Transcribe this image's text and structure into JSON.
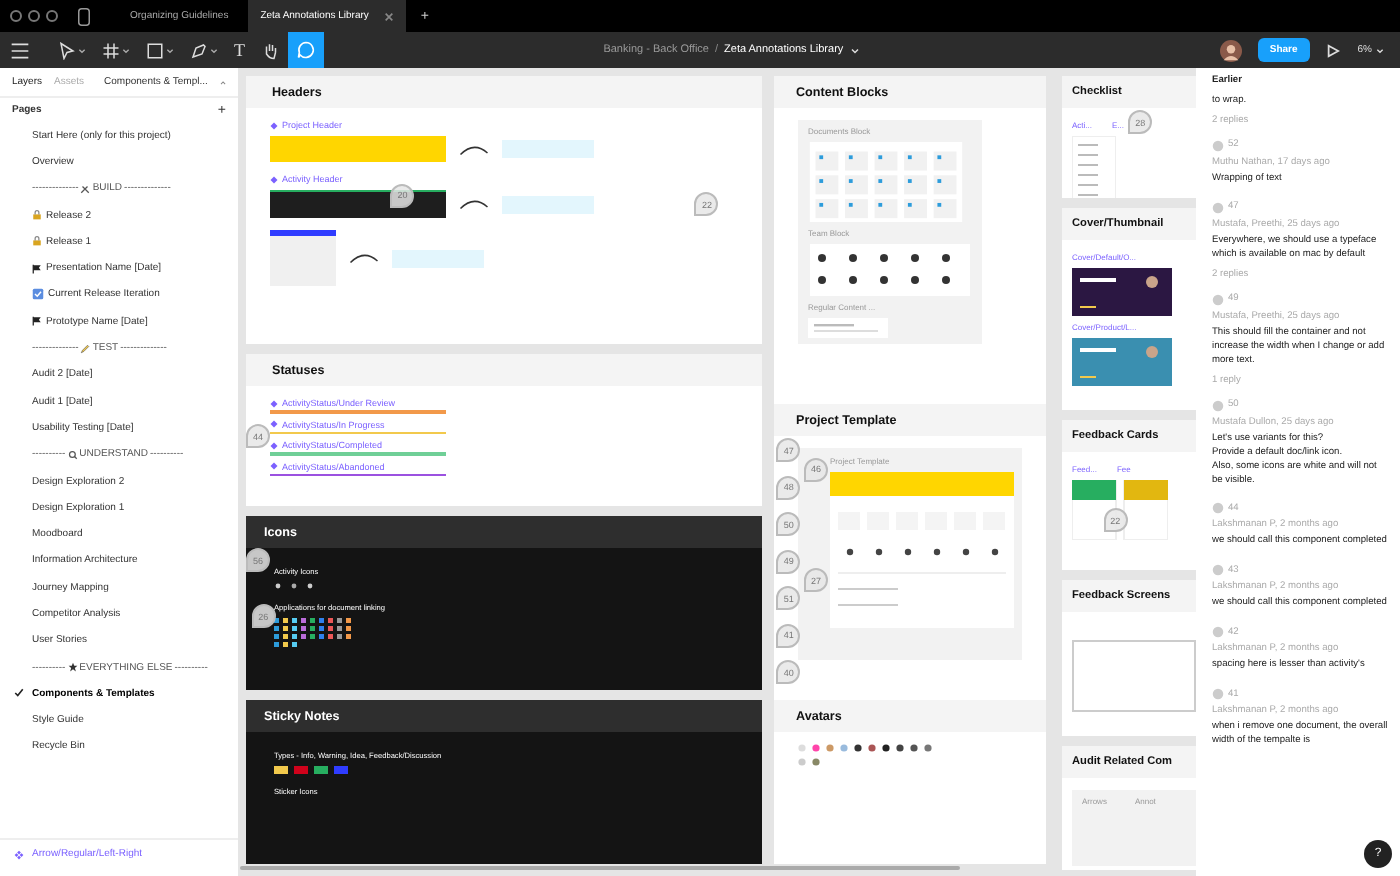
{
  "tabs": [
    {
      "label": "Organizing Guidelines",
      "selected": false,
      "closable": false
    },
    {
      "label": "Zeta Annotations Library",
      "selected": true,
      "closable": true
    }
  ],
  "new_tab": "+",
  "toolbar": {
    "tools": [
      {
        "kind": "move",
        "selected": false
      },
      {
        "kind": "frame",
        "selected": false
      },
      {
        "kind": "shape",
        "selected": false
      },
      {
        "kind": "pen",
        "selected": false
      },
      {
        "kind": "text",
        "glyph": "T",
        "selected": false
      },
      {
        "kind": "hand",
        "selected": false
      },
      {
        "kind": "comment",
        "selected": true
      }
    ],
    "project": "Banking - Back Office",
    "separator": "/",
    "file": "Zeta Annotations Library",
    "share": "Share",
    "zoom": "6%"
  },
  "sidebar": {
    "tabs": [
      {
        "label": "Layers",
        "selected": true
      },
      {
        "label": "Assets",
        "selected": false
      }
    ],
    "page_menu": "Components & Templ...",
    "pages_title": "Pages",
    "add": "+",
    "pages": [
      {
        "kind": "page",
        "label": "Start Here (only for this project)",
        "selected": false
      },
      {
        "kind": "page",
        "label": "Overview",
        "selected": false
      },
      {
        "kind": "divider",
        "left": "--------------",
        "label": "BUILD",
        "right": "--------------"
      },
      {
        "kind": "locked",
        "label": "Release 2",
        "selected": false
      },
      {
        "kind": "locked",
        "label": "Release 1",
        "selected": false
      },
      {
        "kind": "flagged",
        "label": "Presentation Name [Date]",
        "selected": false
      },
      {
        "kind": "checkbox",
        "label": "Current Release Iteration",
        "selected": false
      },
      {
        "kind": "flagged",
        "label": "Prototype Name [Date]",
        "selected": false
      },
      {
        "kind": "divider",
        "left": "--------------",
        "label": "TEST",
        "right": "--------------"
      },
      {
        "kind": "page",
        "label": "Audit 2 [Date]",
        "selected": false
      },
      {
        "kind": "page",
        "label": "Audit 1 [Date]",
        "selected": false
      },
      {
        "kind": "page",
        "label": "Usability Testing [Date]",
        "selected": false
      },
      {
        "kind": "divider",
        "left": "----------",
        "label": "UNDERSTAND",
        "right": "----------"
      },
      {
        "kind": "page",
        "label": "Design Exploration 2",
        "selected": false
      },
      {
        "kind": "page",
        "label": "Design Exploration 1",
        "selected": false
      },
      {
        "kind": "page",
        "label": "Moodboard",
        "selected": false
      },
      {
        "kind": "page",
        "label": "Information Architecture",
        "selected": false
      },
      {
        "kind": "page",
        "label": "Journey Mapping",
        "selected": false
      },
      {
        "kind": "page",
        "label": "Competitor Analysis",
        "selected": false
      },
      {
        "kind": "page",
        "label": "User Stories",
        "selected": false
      },
      {
        "kind": "divider",
        "left": "----------",
        "label": "EVERYTHING ELSE",
        "right": "----------"
      },
      {
        "kind": "page",
        "label": "Components & Templates",
        "selected": true
      },
      {
        "kind": "page",
        "label": "Style Guide",
        "selected": false
      },
      {
        "kind": "page",
        "label": "Recycle Bin",
        "selected": false
      }
    ],
    "selected_layer": "Arrow/Regular/Left-Right"
  },
  "canvas": {
    "columns": [
      [
        {
          "kind": "headers",
          "title": "Headers",
          "dark": false,
          "pins": [
            "20",
            "22"
          ],
          "labels": [
            "Project Header",
            "Activity Header"
          ]
        },
        {
          "kind": "statuses",
          "title": "Statuses",
          "dark": false,
          "pins": [
            "44"
          ],
          "statuses": [
            {
              "label": "ActivityStatus/Under Review",
              "color": "#f2994a"
            },
            {
              "label": "ActivityStatus/In Progress",
              "color": "#f2c94c"
            },
            {
              "label": "ActivityStatus/Completed",
              "color": "#6fcf97"
            },
            {
              "label": "ActivityStatus/Abandoned",
              "color": "#9b51e0"
            }
          ]
        },
        {
          "kind": "icons",
          "title": "Icons",
          "dark": true,
          "pins": [
            "56",
            "26"
          ],
          "labels": [
            "Activity Icons",
            "Applications for document linking"
          ]
        },
        {
          "kind": "sticky",
          "title": "Sticky Notes",
          "dark": true,
          "labels": [
            "Types - Info, Warning, Idea, Feedback/Discussion",
            "Sticker Icons"
          ],
          "swatches": [
            {
              "color": "#f2c94c"
            },
            {
              "color": "#d0021b"
            },
            {
              "color": "#27ae60"
            },
            {
              "color": "#2f3cff"
            }
          ]
        }
      ],
      [
        {
          "kind": "content-blocks",
          "title": "Content Blocks",
          "dark": false,
          "labels": [
            "Documents Block",
            "Team Block",
            "Regular Content ..."
          ]
        },
        {
          "kind": "project-template",
          "title": "Project Template",
          "dark": false,
          "pins": [
            "47",
            "48",
            "50",
            "49",
            "51",
            "41",
            "40",
            "46",
            "27"
          ],
          "labels": [
            "Project Template"
          ]
        },
        {
          "kind": "avatars",
          "title": "Avatars",
          "dark": false
        }
      ],
      [
        {
          "kind": "checklist",
          "title": "Checklist",
          "dark": false,
          "pins": [
            "28"
          ],
          "labels": [
            "Acti...",
            "E..."
          ]
        },
        {
          "kind": "cover",
          "title": "Cover/Thumbnail",
          "dark": false,
          "labels": [
            "Cover/Default/O...",
            "Cover/Product/L..."
          ]
        },
        {
          "kind": "feedback-cards",
          "title": "Feedback Cards",
          "dark": false,
          "pins": [
            "22"
          ],
          "labels": [
            "Feed...",
            "Fee"
          ]
        },
        {
          "kind": "feedback-screens",
          "title": "Feedback Screens",
          "dark": false
        },
        {
          "kind": "audit",
          "title": "Audit Related Com",
          "dark": false,
          "labels": [
            "Arrows",
            "Annot"
          ]
        }
      ]
    ]
  },
  "comments": {
    "heading": "Earlier",
    "help": "?",
    "items": [
      {
        "text": "to wrap.",
        "replies": "2 replies"
      },
      {
        "pin": "52",
        "meta": "Muthu Nathan, 17 days ago",
        "text": "Wrapping of text"
      },
      {
        "pin": "47",
        "meta": "Mustafa, Preethi, 25 days ago",
        "text": "Everywhere, we should use a typeface which is available on mac by default",
        "replies": "2 replies"
      },
      {
        "pin": "49",
        "meta": "Mustafa, Preethi, 25 days ago",
        "text": "This should fill the container and not increase the width when I change or add more text.",
        "replies": "1 reply"
      },
      {
        "pin": "50",
        "meta": "Mustafa Dullon, 25 days ago",
        "text": "Let's use variants for this?\nProvide a default doc/link icon.\nAlso, some icons are white and will not be visible."
      },
      {
        "pin": "44",
        "meta": "Lakshmanan P, 2 months ago",
        "text": "we should call this component completed"
      },
      {
        "pin": "43",
        "meta": "Lakshmanan P, 2 months ago",
        "text": "we should call this component completed"
      },
      {
        "pin": "42",
        "meta": "Lakshmanan P, 2 months ago",
        "text": "spacing here is lesser than activity's"
      },
      {
        "pin": "41",
        "meta": "Lakshmanan P, 2 months ago",
        "text": "when i remove one document, the overall width of the tempalte is"
      }
    ]
  }
}
